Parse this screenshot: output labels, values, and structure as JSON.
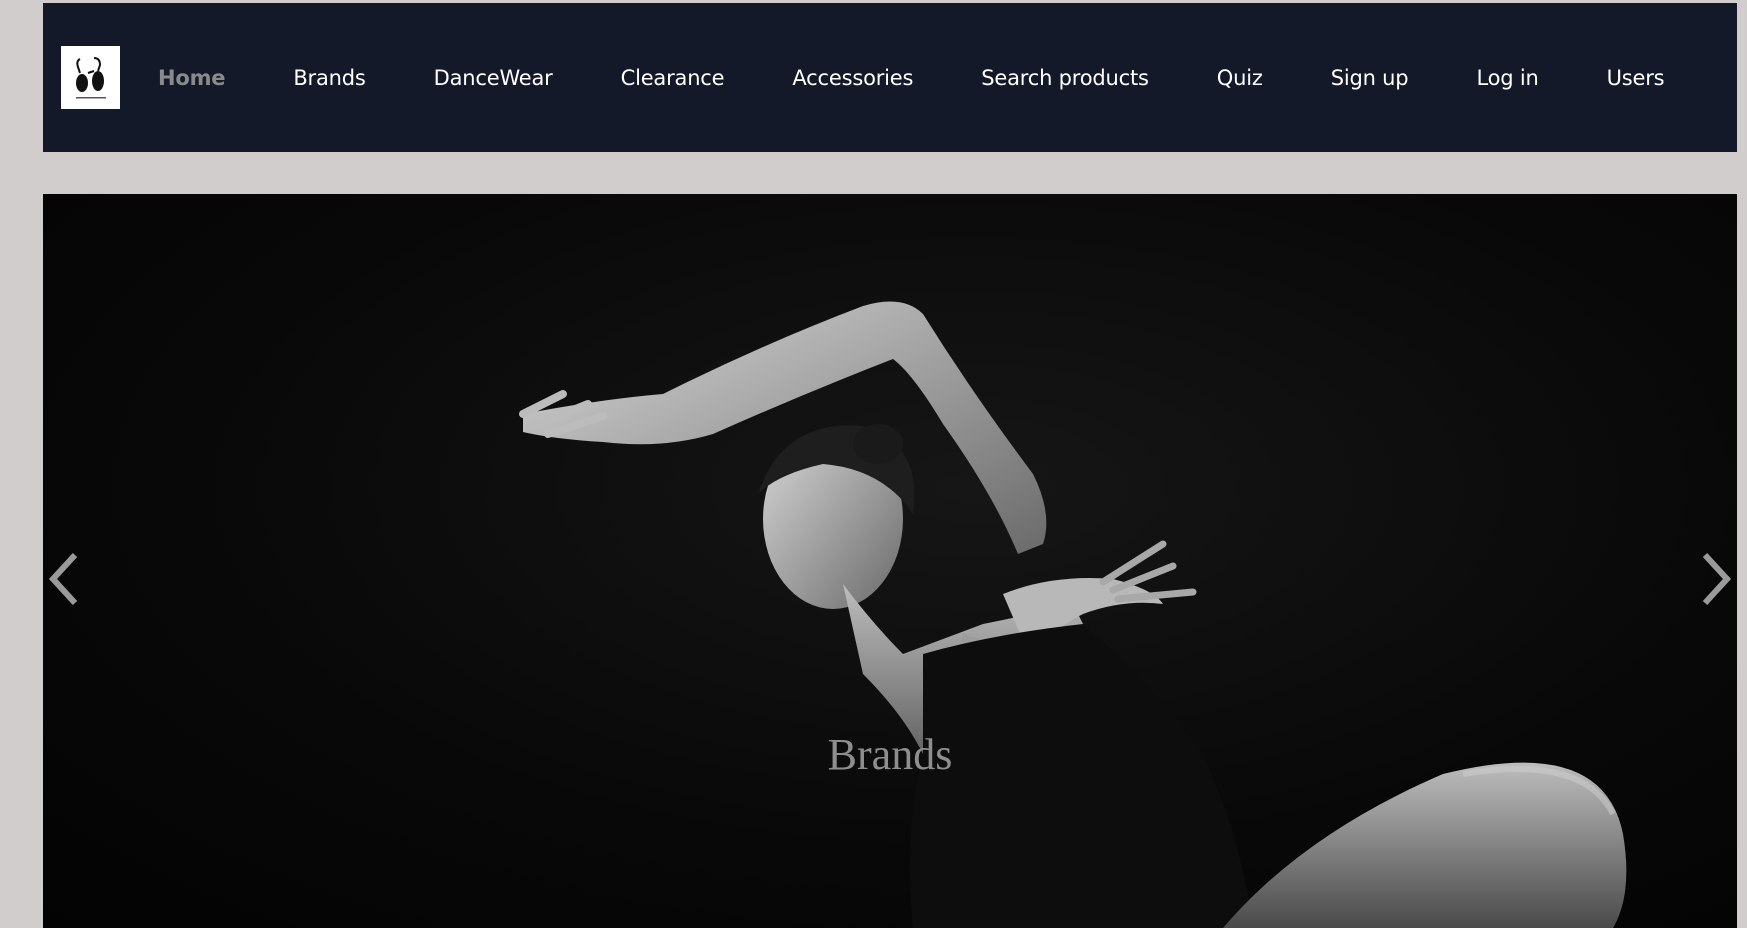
{
  "nav": {
    "logo_icon": "ballet-shoes-logo-icon",
    "items": [
      {
        "label": "Home",
        "active": true
      },
      {
        "label": "Brands"
      },
      {
        "label": "DanceWear"
      },
      {
        "label": "Clearance"
      },
      {
        "label": "Accessories"
      },
      {
        "label": "Search products"
      },
      {
        "label": "Quiz"
      },
      {
        "label": "Sign up"
      },
      {
        "label": "Log in"
      },
      {
        "label": "Users"
      }
    ]
  },
  "carousel": {
    "caption": "Brands",
    "prev_icon": "chevron-left-icon",
    "next_icon": "chevron-right-icon",
    "image": "black-and-white-dancer-photo"
  },
  "colors": {
    "page_bg": "#d0cdcc",
    "navbar_bg": "#131929",
    "nav_text": "#ffffff",
    "nav_active": "#8a8a8a",
    "caption_text": "#8e8e8e"
  }
}
